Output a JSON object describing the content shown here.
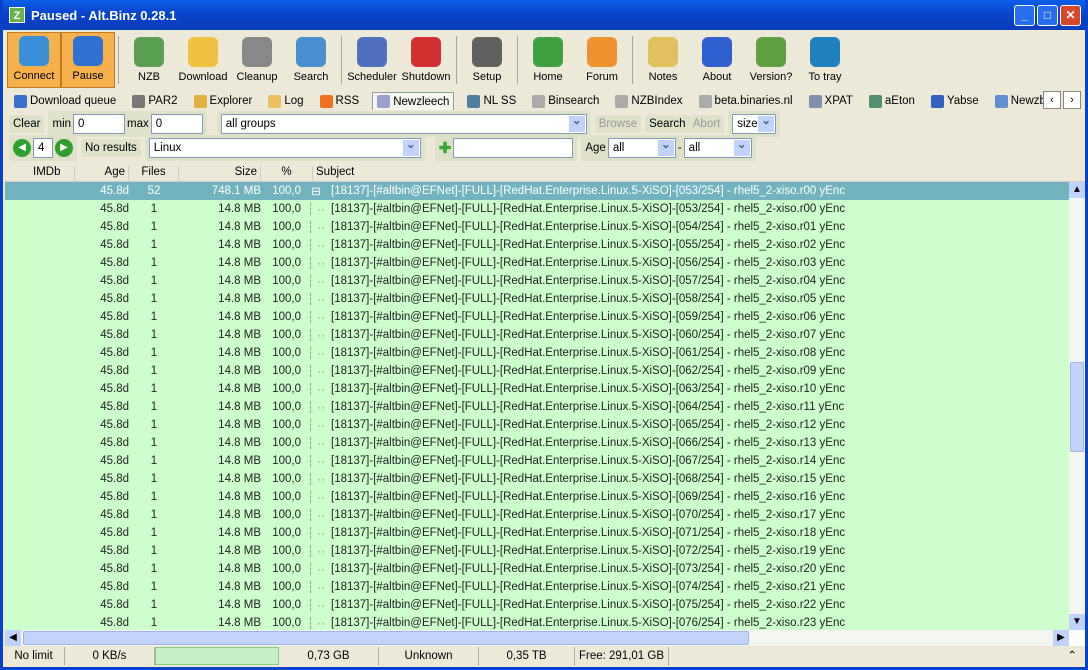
{
  "window": {
    "title": "Paused - Alt.Binz 0.28.1",
    "app_icon": "Z"
  },
  "toolbar": [
    {
      "label": "Connect",
      "icon": "connect-icon",
      "color": "#3a8fd8",
      "active": true
    },
    {
      "label": "Pause",
      "icon": "pause-icon",
      "color": "#3070d0",
      "active": true
    },
    {
      "label": "NZB",
      "icon": "nzb-icon",
      "color": "#5aa050"
    },
    {
      "label": "Download",
      "icon": "folder-icon",
      "color": "#f0c040"
    },
    {
      "label": "Cleanup",
      "icon": "trash-icon",
      "color": "#888888"
    },
    {
      "label": "Search",
      "icon": "search-icon",
      "color": "#4a90d0"
    },
    {
      "label": "Scheduler",
      "icon": "calendar-icon",
      "color": "#5070c0"
    },
    {
      "label": "Shutdown",
      "icon": "power-icon",
      "color": "#d03030"
    },
    {
      "label": "Setup",
      "icon": "gear-icon",
      "color": "#606060"
    },
    {
      "label": "Home",
      "icon": "home-icon",
      "color": "#40a040"
    },
    {
      "label": "Forum",
      "icon": "users-icon",
      "color": "#f09030"
    },
    {
      "label": "Notes",
      "icon": "notes-icon",
      "color": "#e0c060"
    },
    {
      "label": "About",
      "icon": "info-icon",
      "color": "#3060d0"
    },
    {
      "label": "Version?",
      "icon": "version-icon",
      "color": "#60a040"
    },
    {
      "label": "To tray",
      "icon": "tray-icon",
      "color": "#2080c0"
    }
  ],
  "tabs": [
    {
      "label": "Download queue",
      "color": "#3a6fd0"
    },
    {
      "label": "PAR2",
      "color": "#777"
    },
    {
      "label": "Explorer",
      "color": "#e0b040"
    },
    {
      "label": "Log",
      "color": "#e8c060"
    },
    {
      "label": "RSS",
      "color": "#f07020"
    },
    {
      "label": "Newzleech",
      "color": "#9aa0d0",
      "active": true
    },
    {
      "label": "NL SS",
      "color": "#5080a0"
    },
    {
      "label": "Binsearch",
      "color": "#aaa"
    },
    {
      "label": "NZBIndex",
      "color": "#aaa"
    },
    {
      "label": "beta.binaries.nl",
      "color": "#aaa"
    },
    {
      "label": "XPAT",
      "color": "#8090b0"
    },
    {
      "label": "aEton",
      "color": "#509070"
    },
    {
      "label": "Yabse",
      "color": "#3060c0"
    },
    {
      "label": "Newzbin",
      "color": "#6090d0"
    }
  ],
  "filters": {
    "clear": "Clear",
    "min_label": "min",
    "min": "0",
    "max_label": "max",
    "max": "0",
    "group": "all groups",
    "browse": "Browse",
    "search": "Search",
    "abort": "Abort",
    "sort": "size",
    "page": "4",
    "no_results": "No results",
    "query": "Linux",
    "add_value": "",
    "age_label": "Age",
    "age_from": "all",
    "dash": "-",
    "age_to": "all"
  },
  "columns": [
    "IMDb",
    "Age",
    "Files",
    "Size",
    "%",
    "Subject"
  ],
  "rows": [
    {
      "age": "45.8d",
      "files": "52",
      "size": "748.1 MB",
      "pct": "100,0",
      "tree": "⊟",
      "subject": "[18137]-[#altbin@EFNet]-[FULL]-[RedHat.Enterprise.Linux.5-XiSO]-[053/254] - rhel5_2-xiso.r00 yEnc",
      "selected": true
    }
  ],
  "child": {
    "age": "45.8d",
    "files": "1",
    "size": "14.8 MB",
    "pct": "100,0",
    "prefix": "[18137]-[#altbin@EFNet]-[FULL]-[RedHat.Enterprise.Linux.5-XiSO]-",
    "suffix": " yEnc"
  },
  "child_parts": [
    "[053/254] - rhel5_2-xiso.r00",
    "[054/254] - rhel5_2-xiso.r01",
    "[055/254] - rhel5_2-xiso.r02",
    "[056/254] - rhel5_2-xiso.r03",
    "[057/254] - rhel5_2-xiso.r04",
    "[058/254] - rhel5_2-xiso.r05",
    "[059/254] - rhel5_2-xiso.r06",
    "[060/254] - rhel5_2-xiso.r07",
    "[061/254] - rhel5_2-xiso.r08",
    "[062/254] - rhel5_2-xiso.r09",
    "[063/254] - rhel5_2-xiso.r10",
    "[064/254] - rhel5_2-xiso.r11",
    "[065/254] - rhel5_2-xiso.r12",
    "[066/254] - rhel5_2-xiso.r13",
    "[067/254] - rhel5_2-xiso.r14",
    "[068/254] - rhel5_2-xiso.r15",
    "[069/254] - rhel5_2-xiso.r16",
    "[070/254] - rhel5_2-xiso.r17",
    "[071/254] - rhel5_2-xiso.r18",
    "[072/254] - rhel5_2-xiso.r19",
    "[073/254] - rhel5_2-xiso.r20",
    "[074/254] - rhel5_2-xiso.r21",
    "[075/254] - rhel5_2-xiso.r22",
    "[076/254] - rhel5_2-xiso.r23"
  ],
  "status": {
    "limit": "No limit",
    "speed": "0 KB/s",
    "progress": 0,
    "queue": "0,73 GB",
    "eta": "Unknown",
    "total": "0,35 TB",
    "free": "Free: 291,01 GB"
  }
}
